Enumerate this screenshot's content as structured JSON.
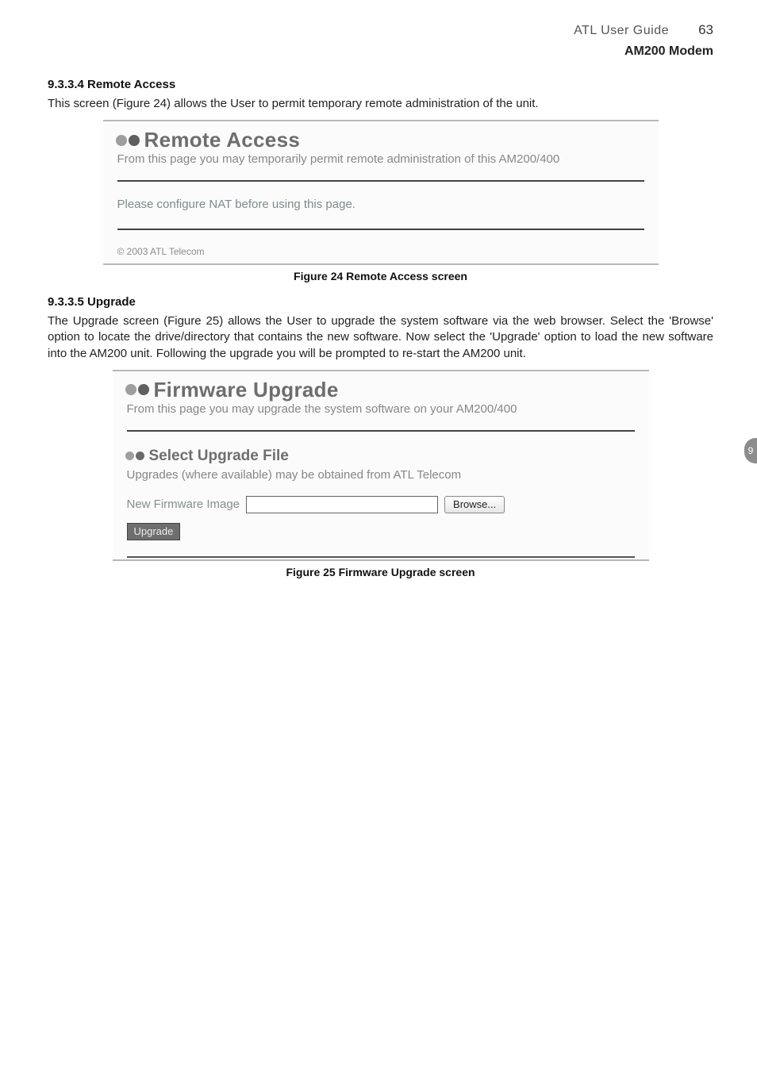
{
  "header": {
    "title": "ATL User Guide",
    "page_number": "63",
    "subtitle": "AM200 Modem"
  },
  "section_remote": {
    "heading": "9.3.3.4 Remote Access",
    "intro": "This screen (Figure 24) allows the User to permit temporary remote administration of the unit.",
    "panel_title": "Remote Access",
    "panel_desc": "From this page you may temporarily permit remote administration of this AM200/400",
    "nat_prefix": "Please configure ",
    "nat_link": "NAT",
    "nat_suffix": " before using this page.",
    "copyright": "© 2003 ATL Telecom",
    "caption": "Figure 24 Remote Access screen"
  },
  "section_upgrade": {
    "heading": "9.3.3.5 Upgrade",
    "intro": "The Upgrade screen (Figure 25) allows the User to upgrade the system software via the web browser. Select the 'Browse' option to locate the drive/directory that contains the new software. Now select the 'Upgrade' option to load the new software into the AM200 unit. Following the upgrade you will be prompted to re-start the AM200 unit.",
    "panel_title": "Firmware Upgrade",
    "panel_desc": "From this page you may upgrade the system software on your AM200/400",
    "select_heading": "Select Upgrade File",
    "obtain_prefix": "Upgrades (where available) may be obtained from ",
    "obtain_link": "ATL Telecom",
    "form_label": "New Firmware Image",
    "browse_label": "Browse...",
    "upgrade_label": "Upgrade",
    "caption": "Figure 25 Firmware Upgrade screen"
  },
  "side_tab": "9"
}
